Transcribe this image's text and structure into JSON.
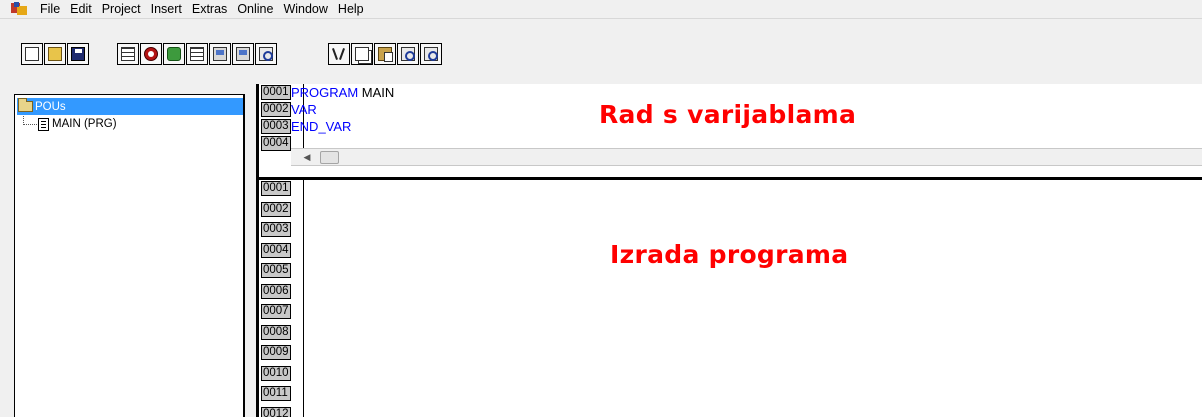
{
  "menu": {
    "items": [
      "File",
      "Edit",
      "Project",
      "Insert",
      "Extras",
      "Online",
      "Window",
      "Help"
    ]
  },
  "toolbar": {
    "groups": [
      [
        "new-document-icon",
        "open-folder-icon",
        "save-disk-icon"
      ],
      [
        "variable-list-icon",
        "stop-st-icon",
        "gear-icon",
        "grid-edit-icon",
        "computer-icon",
        "computer-go-icon",
        "search-find-icon"
      ],
      [
        "scissors-cut-icon",
        "copy-icon",
        "paste-icon",
        "find-icon",
        "find-replace-icon"
      ]
    ]
  },
  "tree": {
    "root_label": "POUs",
    "children": [
      {
        "label": "MAIN (PRG)"
      }
    ]
  },
  "declaration": {
    "line_numbers": [
      "0001",
      "0002",
      "0003",
      "0004"
    ],
    "lines": [
      [
        {
          "t": "PROGRAM",
          "kw": true
        },
        {
          "t": " MAIN",
          "kw": false
        }
      ],
      [
        {
          "t": "VAR",
          "kw": true
        }
      ],
      [
        {
          "t": "END_VAR",
          "kw": true
        }
      ]
    ]
  },
  "body": {
    "line_numbers": [
      "0001",
      "0002",
      "0003",
      "0004",
      "0005",
      "0006",
      "0007",
      "0008",
      "0009",
      "0010",
      "0011",
      "0012"
    ]
  },
  "annotations": {
    "declaration_label": "Rad s varijablama",
    "body_label": "Izrada programa"
  },
  "colors": {
    "keyword": "#0000ff",
    "selection": "#3399ff",
    "annotation": "#ff0000",
    "line_number_bg": "#c8c8c8"
  }
}
